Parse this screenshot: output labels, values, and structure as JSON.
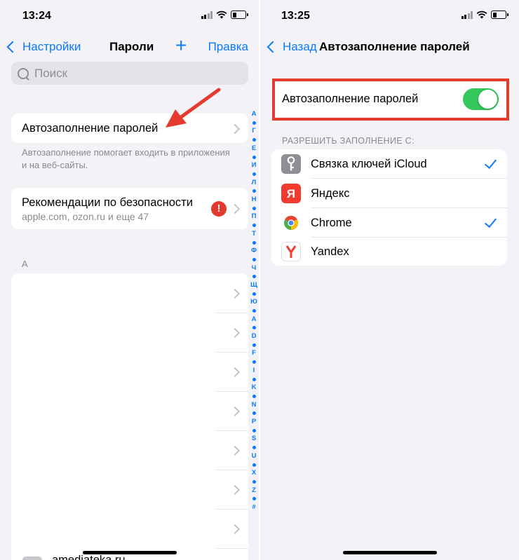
{
  "left": {
    "status": {
      "time": "13:24"
    },
    "nav": {
      "back_label": "Настройки",
      "title": "Пароли",
      "add_label": "+",
      "edit_label": "Правка"
    },
    "search": {
      "placeholder": "Поиск"
    },
    "autofill_row": {
      "label": "Автозаполнение паролей",
      "footnote": "Автозаполнение помогает входить в приложения и на веб-сайты."
    },
    "security_row": {
      "label": "Рекомендации по безопасности",
      "subtitle": "apple.com, ozon.ru и еще 47",
      "alert": "!"
    },
    "section_header": "A",
    "partial_row_label": "amediateka.ru",
    "index_letters": [
      "А",
      "Г",
      "Е",
      "И",
      "Л",
      "Н",
      "П",
      "Т",
      "Ф",
      "Ч",
      "Щ",
      "Ю",
      "A",
      "D",
      "F",
      "I",
      "K",
      "N",
      "P",
      "S",
      "U",
      "X",
      "Z",
      "#"
    ]
  },
  "right": {
    "status": {
      "time": "13:25"
    },
    "nav": {
      "back_label": "Назад",
      "title": "Автозаполнение паролей"
    },
    "toggle_row": {
      "label": "Автозаполнение паролей",
      "toggle_on": true,
      "accent": "#34c759",
      "highlight": "#e53a2e"
    },
    "section_header": "РАЗРЕШИТЬ ЗАПОЛНЕНИЕ С:",
    "providers": [
      {
        "label": "Связка ключей iCloud",
        "icon": "key-icon",
        "checked": true
      },
      {
        "label": "Яндекс",
        "icon": "yandex-red-icon",
        "checked": false
      },
      {
        "label": "Chrome",
        "icon": "chrome-icon",
        "checked": true
      },
      {
        "label": "Yandex",
        "icon": "yandex-browser-icon",
        "checked": false
      }
    ]
  }
}
